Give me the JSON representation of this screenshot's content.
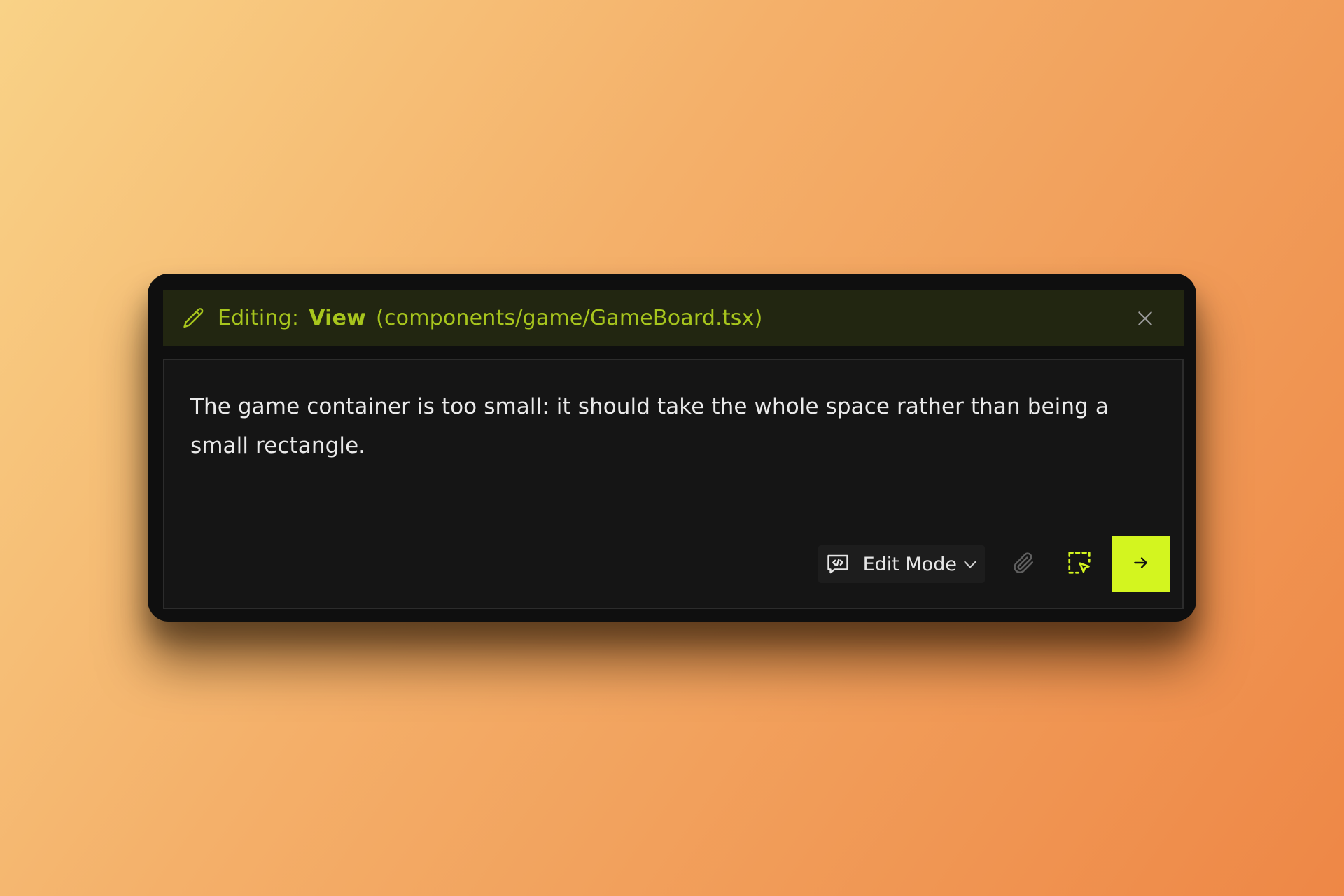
{
  "editing_bar": {
    "label": "Editing:",
    "component": "View",
    "file": "(components/game/GameBoard.tsx)"
  },
  "prompt": {
    "text": "The game container is too small: it should take the whole space rather than being a small rectangle."
  },
  "toolbar": {
    "mode_label": "Edit Mode"
  },
  "icons": {
    "edit": "pencil-icon",
    "close": "close-icon",
    "mode": "chat-code-icon",
    "mode_dropdown": "chevron-down-icon",
    "attach": "paperclip-icon",
    "select_element": "select-element-icon",
    "send": "arrow-right-icon"
  },
  "colors": {
    "accent": "#d3f51f",
    "accent_text": "#a7c51d",
    "panel": "#0f0f0f",
    "edit_bar": "#222611"
  }
}
